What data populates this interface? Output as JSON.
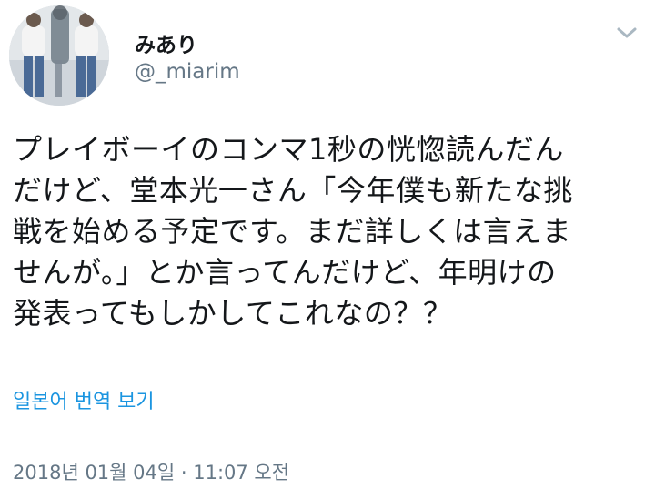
{
  "user": {
    "display_name": "みあり",
    "handle": "@_miarim"
  },
  "icons": {
    "avatar": "avatar-photo",
    "menu": "chevron-down-icon"
  },
  "tweet": {
    "text": "プレイボーイのコンマ1秒の恍惚読んだん\nだけど、堂本光一さん「今年僕も新たな挑\n戦を始める予定です。まだ詳しくは言えま\nせんが。」とか言ってんだけど、年明けの\n発表ってもしかしてこれなの？？",
    "translate_label": "일본어 번역 보기",
    "timestamp": "2018년 01월 04일 · 11:07 오전"
  },
  "colors": {
    "text": "#14171a",
    "secondary": "#657786",
    "link": "#1b95e0",
    "caret": "#aab8c2"
  }
}
